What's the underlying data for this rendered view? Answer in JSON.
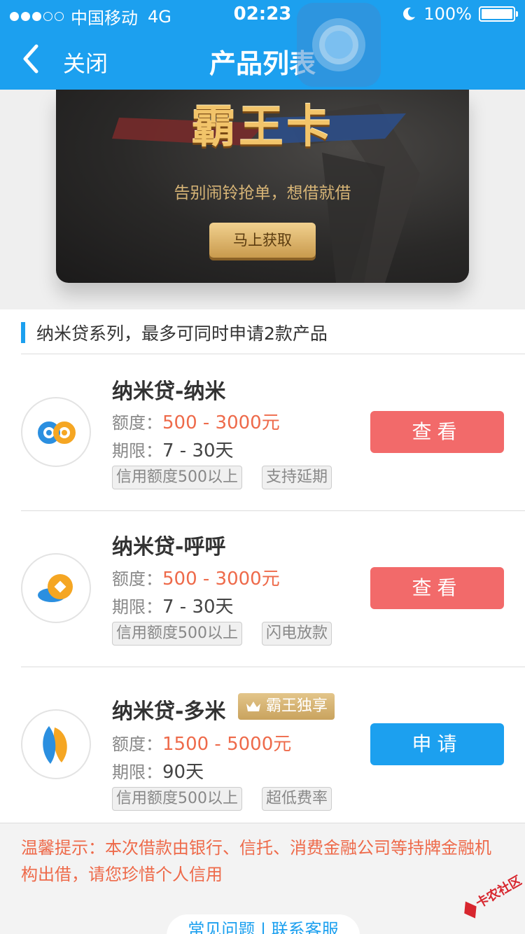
{
  "status_bar": {
    "carrier": "中国移动",
    "network": "4G",
    "time": "02:23",
    "battery": "100%"
  },
  "nav": {
    "back_label": "关闭",
    "title": "产品列表"
  },
  "banner": {
    "title": "霸王卡",
    "subtitle": "告别闹铃抢单，想借就借",
    "button": "马上获取"
  },
  "section": {
    "heading": "纳米贷系列，最多可同时申请2款产品"
  },
  "products": [
    {
      "name": "纳米贷-纳米",
      "amount_label": "额度：",
      "amount": "500 - 3000元",
      "term_label": "期限：",
      "term": "7 - 30天",
      "tags": [
        "信用额度500以上",
        "支持延期"
      ],
      "button": "查看"
    },
    {
      "name": "纳米贷-呼呼",
      "amount_label": "额度：",
      "amount": "500 - 3000元",
      "term_label": "期限：",
      "term": "7 - 30天",
      "tags": [
        "信用额度500以上",
        "闪电放款"
      ],
      "button": "查看"
    },
    {
      "name": "纳米贷-多米",
      "badge": "霸王独享",
      "amount_label": "额度：",
      "amount": "1500 - 5000元",
      "term_label": "期限：",
      "term": "90天",
      "tags": [
        "信用额度500以上",
        "超低费率"
      ],
      "button": "申请"
    }
  ],
  "notice": "温馨提示：本次借款由银行、信托、消费金融公司等持牌金融机构出借，请您珍惜个人信用",
  "help_link": "常见问题 | 联系客服",
  "watermark": "卡农社区",
  "colors": {
    "primary": "#1ca0ef",
    "danger": "#f26a6a",
    "accent_red": "#ee6a4a",
    "gold": "#c9a35e"
  },
  "icons": {
    "back": "chevron-left-icon",
    "moon": "moon-icon",
    "battery": "battery-icon",
    "crown": "crown-icon",
    "logo1": "infinity-logo-icon",
    "logo2": "coin-logo-icon",
    "logo3": "petal-logo-icon"
  }
}
